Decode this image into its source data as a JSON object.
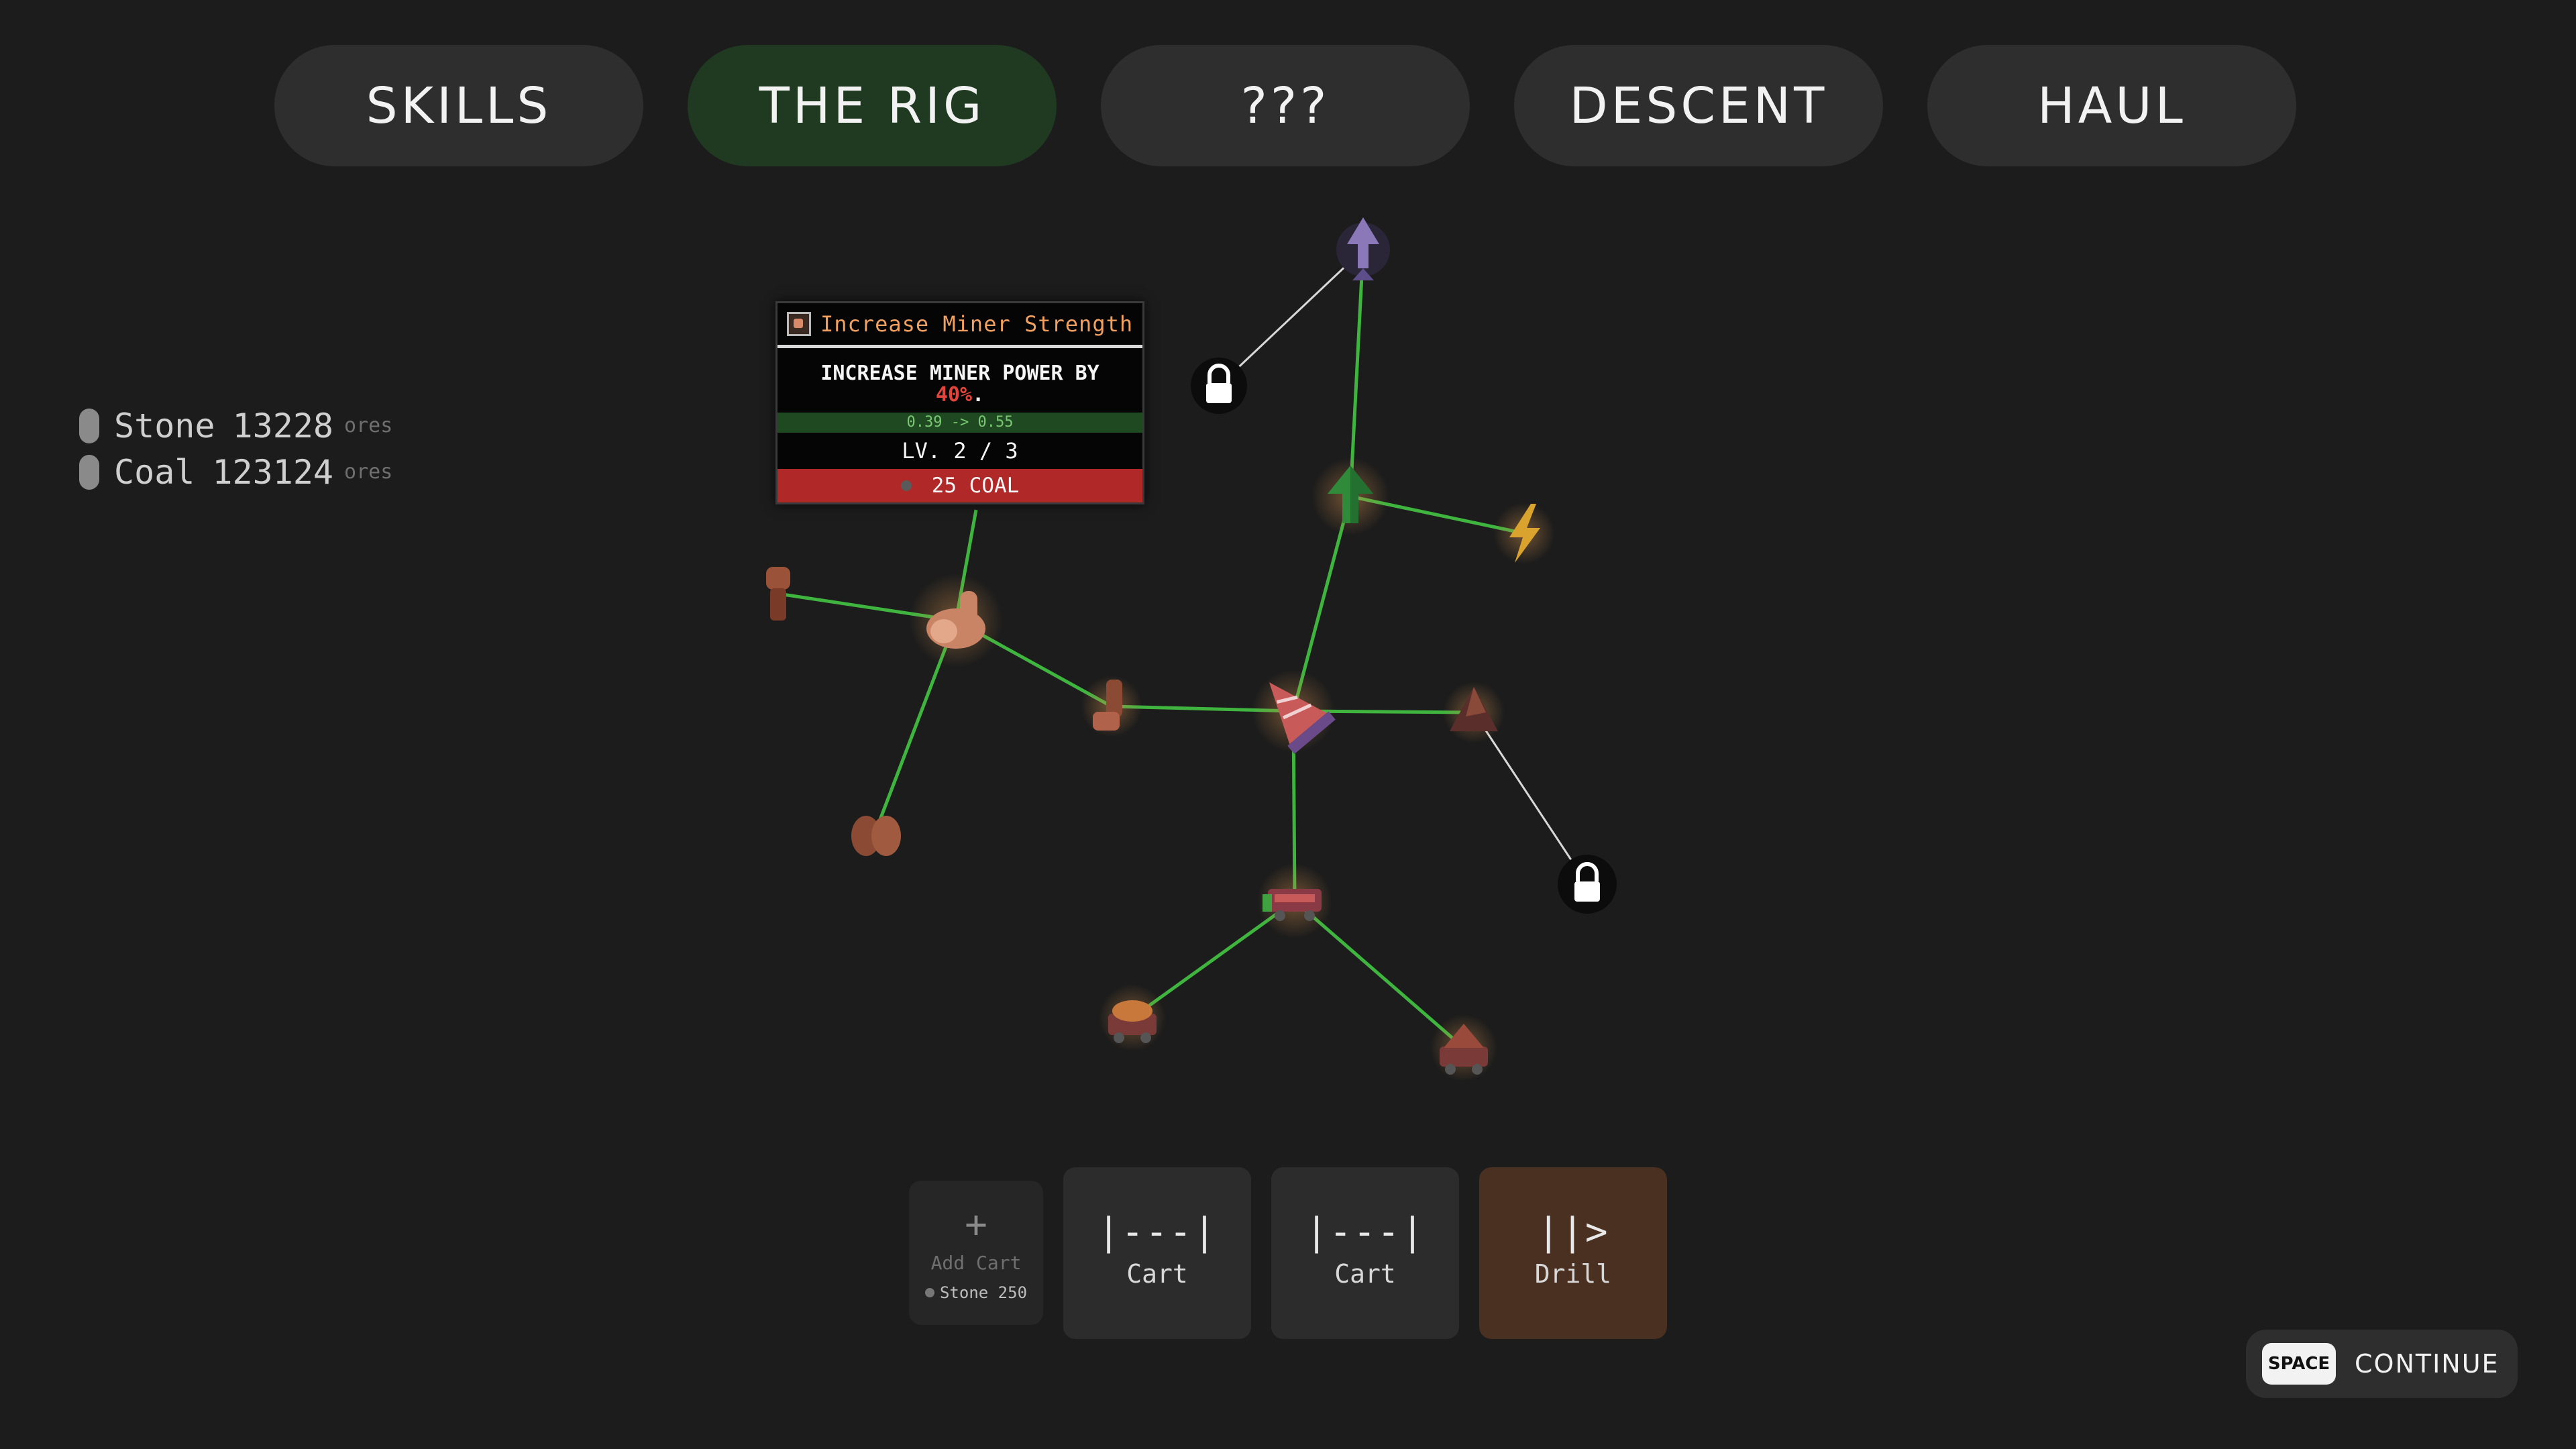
{
  "tabs": [
    {
      "label": "SKILLS",
      "active": false
    },
    {
      "label": "THE RIG",
      "active": true
    },
    {
      "label": "???",
      "active": false
    },
    {
      "label": "DESCENT",
      "active": false
    },
    {
      "label": "HAUL",
      "active": false
    }
  ],
  "resources": [
    {
      "name": "Stone",
      "amount": "13228",
      "unit": "ores"
    },
    {
      "name": "Coal",
      "amount": "123124",
      "unit": "ores"
    }
  ],
  "tooltip": {
    "title": "Increase Miner Strength",
    "desc_text": "INCREASE MINER POWER BY",
    "desc_pct": "40%",
    "desc_end": ".",
    "stat_change": "0.39 -> 0.55",
    "level": "LV. 2 / 3",
    "cost": "25 COAL"
  },
  "tree_nodes": [
    "drill-tip-icon",
    "lock-icon",
    "upgrade-arrow-icon",
    "lightning-icon",
    "fist-icon",
    "flexed-arm-icon",
    "pickaxe-arm-icon",
    "drill-icon",
    "rock-pile-icon",
    "lock-icon",
    "hands-icon",
    "cart-engine-icon",
    "ore-cart-icon",
    "ore-cart-heap-icon"
  ],
  "bottom_bar": {
    "add_cart": {
      "plus": "+",
      "label": "Add Cart",
      "cost": "Stone 250"
    },
    "carts": [
      {
        "glyph": "|---|",
        "label": "Cart"
      },
      {
        "glyph": "|---|",
        "label": "Cart"
      },
      {
        "glyph": "||>",
        "label": "Drill"
      }
    ]
  },
  "continue": {
    "key": "SPACE",
    "label": "CONTINUE"
  },
  "colors": {
    "background": "#1c1c1c",
    "active_tab": "#1f3a21",
    "link_green": "#3fb43f",
    "cost_red": "#b02828",
    "drill_card": "#4a3020"
  }
}
